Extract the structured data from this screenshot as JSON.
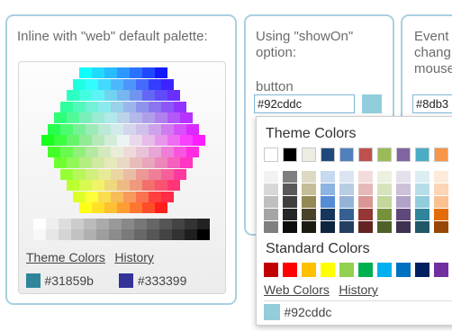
{
  "panel1": {
    "title": "Inline with \"web\" default palette:",
    "links": {
      "theme": "Theme Colors",
      "history": "History"
    },
    "history": [
      {
        "hex": "#31859b",
        "label": "#31859b"
      },
      {
        "hex": "#333399",
        "label": "#333399"
      }
    ]
  },
  "panel2": {
    "title_line1": "Using \"showOn\"",
    "title_line2": "option:",
    "subtitle": "button",
    "input_value": "#92cddc",
    "button_color": "#92cddc"
  },
  "panel3": {
    "title_line1": "Event",
    "title_line2": "chang",
    "title_line3": "mouse",
    "input_value": "#8db3"
  },
  "popup": {
    "theme_heading": "Theme Colors",
    "standard_heading": "Standard Colors",
    "links": {
      "web": "Web Colors",
      "history": "History"
    },
    "selected": {
      "hex": "#92cddc",
      "label": "#92cddc"
    },
    "theme_top": [
      "#ffffff",
      "#000000",
      "#eeece1",
      "#1f497d",
      "#4f81bd",
      "#c0504d",
      "#9bbb59",
      "#8064a2",
      "#4bacc6",
      "#f79646"
    ],
    "theme_shades": [
      [
        "#f2f2f2",
        "#d8d8d8",
        "#bfbfbf",
        "#a5a5a5",
        "#7f7f7f"
      ],
      [
        "#7f7f7f",
        "#595959",
        "#3f3f3f",
        "#262626",
        "#0c0c0c"
      ],
      [
        "#ddd9c3",
        "#c4bd97",
        "#938953",
        "#494429",
        "#1d1b10"
      ],
      [
        "#c6d9f0",
        "#8db3e2",
        "#548dd4",
        "#17365d",
        "#0f243e"
      ],
      [
        "#dbe5f1",
        "#b8cce4",
        "#95b3d7",
        "#366092",
        "#244061"
      ],
      [
        "#f2dcdb",
        "#e5b9b7",
        "#d99694",
        "#953734",
        "#632423"
      ],
      [
        "#ebf1dd",
        "#d7e3bc",
        "#c3d69b",
        "#76923c",
        "#4f6128"
      ],
      [
        "#e5e0ec",
        "#ccc1d9",
        "#b2a2c7",
        "#5f497a",
        "#3f3151"
      ],
      [
        "#dbeef3",
        "#b7dde8",
        "#92cddc",
        "#31859b",
        "#205867"
      ],
      [
        "#fdeada",
        "#fbd5b5",
        "#fac08f",
        "#e36c09",
        "#974806"
      ]
    ],
    "standard": [
      "#c00000",
      "#ff0000",
      "#ffc000",
      "#ffff00",
      "#92d050",
      "#00b050",
      "#00b0f0",
      "#0070c0",
      "#002060",
      "#7030a0"
    ]
  },
  "icons": {
    "hexagon_palette": "color-hexagon",
    "grayscale": "grayscale-strip"
  }
}
